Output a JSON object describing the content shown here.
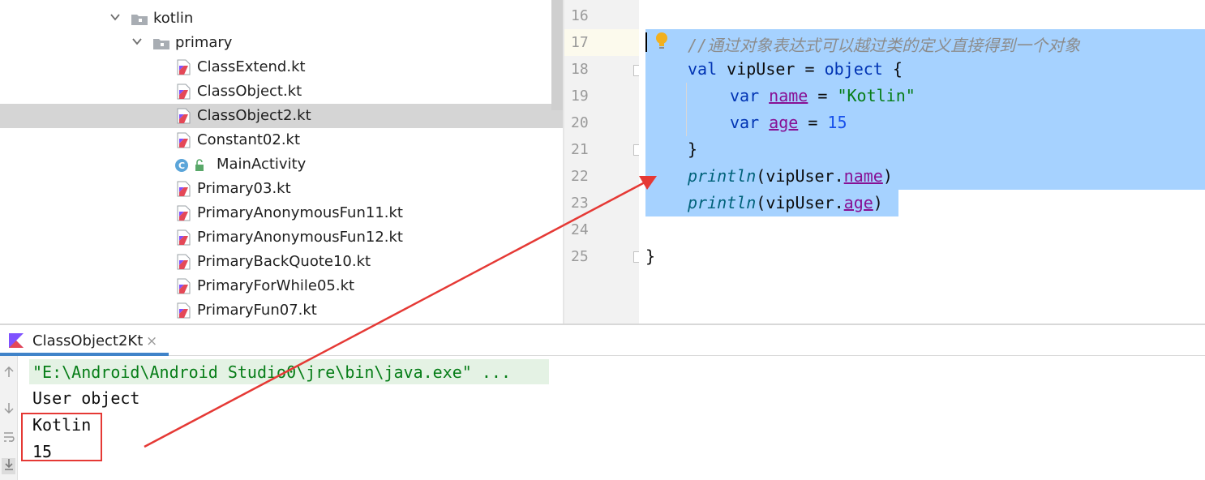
{
  "project_tree": {
    "folders": [
      {
        "label": "kotlin"
      },
      {
        "label": "primary"
      }
    ],
    "files": [
      {
        "label": "ClassExtend.kt",
        "selected": false
      },
      {
        "label": "ClassObject.kt",
        "selected": false
      },
      {
        "label": "ClassObject2.kt",
        "selected": true
      },
      {
        "label": "Constant02.kt",
        "selected": false
      },
      {
        "label": "MainActivity",
        "selected": false
      },
      {
        "label": "Primary03.kt",
        "selected": false
      },
      {
        "label": "PrimaryAnonymousFun11.kt",
        "selected": false
      },
      {
        "label": "PrimaryAnonymousFun12.kt",
        "selected": false
      },
      {
        "label": "PrimaryBackQuote10.kt",
        "selected": false
      },
      {
        "label": "PrimaryForWhile05.kt",
        "selected": false
      },
      {
        "label": "PrimaryFun07.kt",
        "selected": false
      }
    ]
  },
  "editor": {
    "line_numbers": [
      "16",
      "17",
      "18",
      "19",
      "20",
      "21",
      "22",
      "23",
      "24",
      "25"
    ],
    "lines": {
      "l17_comment": "//通过对象表达式可以越过类的定义直接得到一个对象",
      "l18_val": "val",
      "l18_name": " vipUser = ",
      "l18_object": "object",
      "l18_brace": " {",
      "l19_var": "var",
      "l19_sp": " ",
      "l19_prop": "name",
      "l19_eq": " = ",
      "l19_str": "\"Kotlin\"",
      "l20_var": "var",
      "l20_sp": " ",
      "l20_prop": "age",
      "l20_eq": " = ",
      "l20_num": "15",
      "l21_close": "}",
      "l22_fn": "println",
      "l22_open": "(vipUser.",
      "l22_prop": "name",
      "l22_close": ")",
      "l23_fn": "println",
      "l23_open": "(vipUser.",
      "l23_prop": "age",
      "l23_close": ")",
      "l25_close": "}"
    }
  },
  "run_panel": {
    "tab_label": "ClassObject2Kt",
    "close_glyph": "×",
    "console_lines": [
      "\"E:\\Android\\Android Studio0\\jre\\bin\\java.exe\" ...",
      "User object",
      "Kotlin",
      "15"
    ]
  },
  "colors": {
    "selection": "#a6d2ff",
    "annotation_red": "#e53935",
    "keyword": "#0033b3",
    "string": "#067d17",
    "number": "#1750eb",
    "property": "#871094"
  }
}
